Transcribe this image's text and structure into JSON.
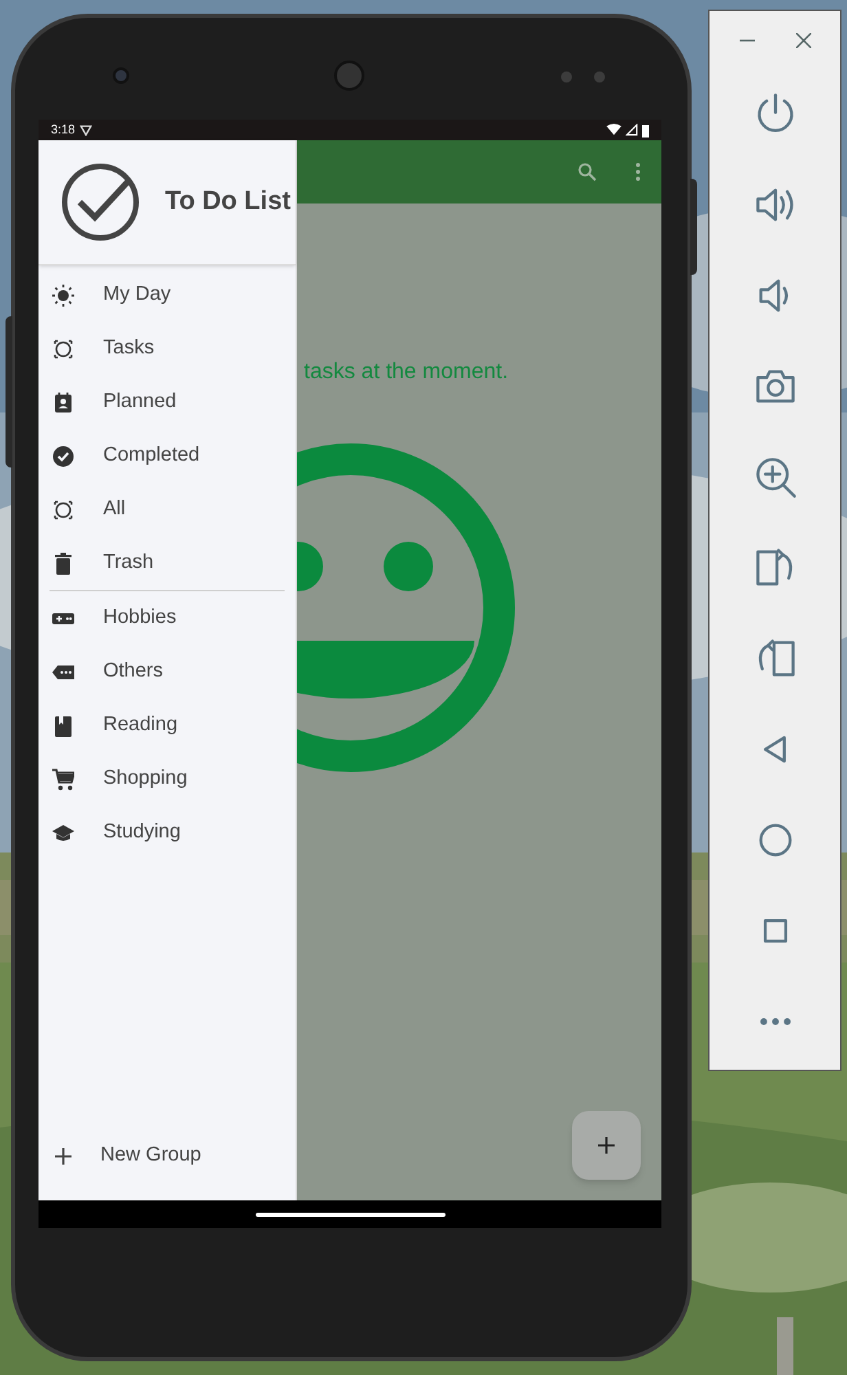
{
  "status_bar": {
    "time": "3:18"
  },
  "drawer": {
    "title": "To Do List",
    "nav_items": [
      {
        "label": "My Day"
      },
      {
        "label": "Tasks"
      },
      {
        "label": "Planned"
      },
      {
        "label": "Completed"
      },
      {
        "label": "All"
      },
      {
        "label": "Trash"
      }
    ],
    "group_items": [
      {
        "label": "Hobbies"
      },
      {
        "label": "Others"
      },
      {
        "label": "Reading"
      },
      {
        "label": "Shopping"
      },
      {
        "label": "Studying"
      }
    ],
    "new_group": {
      "label": "New Group"
    }
  },
  "content": {
    "empty_message": "tasks at the moment."
  }
}
